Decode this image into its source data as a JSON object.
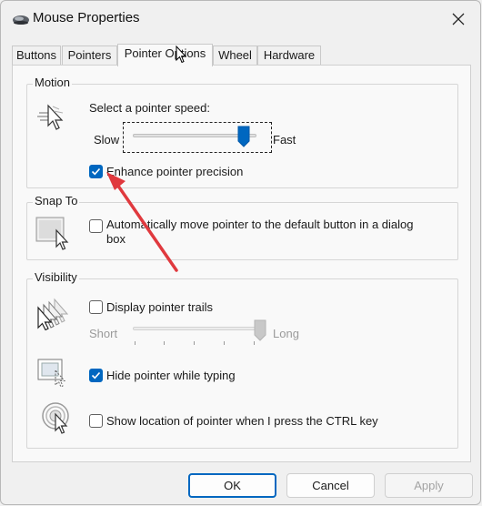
{
  "window": {
    "title": "Mouse Properties"
  },
  "tabs": [
    {
      "label": "Buttons"
    },
    {
      "label": "Pointers"
    },
    {
      "label": "Pointer Options"
    },
    {
      "label": "Wheel"
    },
    {
      "label": "Hardware"
    }
  ],
  "active_tab": "Pointer Options",
  "motion": {
    "title": "Motion",
    "speed_label": "Select a pointer speed:",
    "slow_label": "Slow",
    "fast_label": "Fast",
    "speed_level": 0.9,
    "precision": {
      "label": "Enhance pointer precision",
      "checked": true
    }
  },
  "snap_to": {
    "title": "Snap To",
    "auto_move": {
      "label": "Automatically move pointer to the default button in a dialog box",
      "checked": false
    }
  },
  "visibility": {
    "title": "Visibility",
    "trails": {
      "label": "Display pointer trails",
      "checked": false
    },
    "short_label": "Short",
    "long_label": "Long",
    "trail_level": 1.0,
    "hide_typing": {
      "label": "Hide pointer while typing",
      "checked": true
    },
    "show_ctrl": {
      "label": "Show location of pointer when I press the CTRL key",
      "checked": false
    }
  },
  "buttons": {
    "ok": "OK",
    "cancel": "Cancel",
    "apply": "Apply"
  },
  "colors": {
    "accent": "#0067c0",
    "arrow": "#e0393e"
  },
  "icons": [
    "mouse-icon",
    "close-icon",
    "pointer-speed-icon",
    "snap-to-icon",
    "pointer-trails-icon",
    "hide-pointer-icon",
    "ctrl-locate-icon"
  ]
}
